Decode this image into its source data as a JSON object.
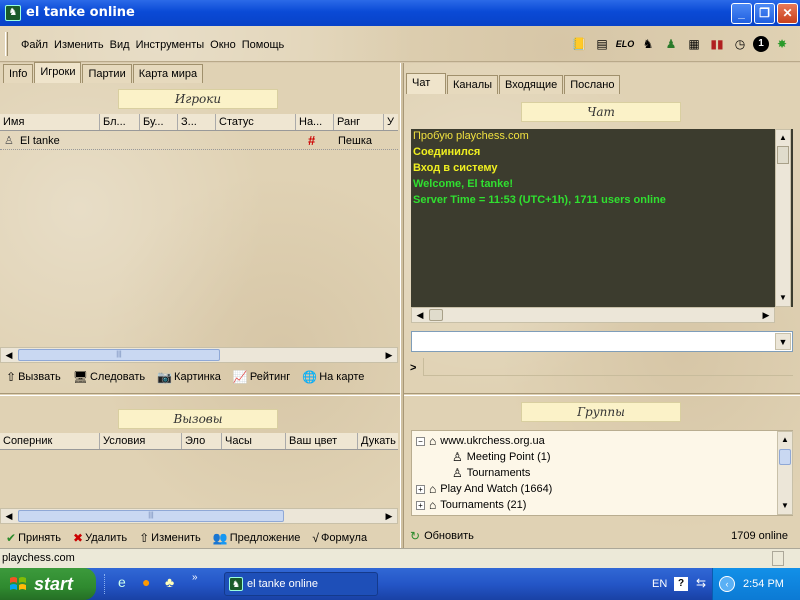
{
  "window": {
    "title": "el tanke online",
    "app_icon": "chess-knight-icon"
  },
  "menu": {
    "items": [
      "Файл",
      "Изменить",
      "Вид",
      "Инструменты",
      "Окно",
      "Помощь"
    ]
  },
  "toolbar": {
    "icons": [
      "book-icon",
      "list-icon",
      "elo-icon",
      "knight-icon",
      "player-icon",
      "board-icon",
      "chart-icon",
      "clock-icon",
      "number-one-icon",
      "star-icon"
    ],
    "elo_label": "ELO"
  },
  "left": {
    "tabs": [
      "Info",
      "Игроки",
      "Партии",
      "Карта мира"
    ],
    "active_tab": "Игроки",
    "players": {
      "title": "Игроки",
      "columns": [
        "Имя",
        "Бл...",
        "Бу...",
        "З...",
        "Статус",
        "На...",
        "Ранг",
        "У"
      ],
      "rows": [
        {
          "name": "El tanke",
          "flag": "#",
          "rank": "Пешка"
        }
      ]
    },
    "player_buttons": [
      "Вызвать",
      "Следовать",
      "Картинка",
      "Рейтинг",
      "На карте"
    ],
    "challenges": {
      "title": "Вызовы",
      "columns": [
        "Соперник",
        "Условия",
        "Эло",
        "Часы",
        "Ваш цвет",
        "Дукать"
      ]
    },
    "challenge_buttons": [
      "Принять",
      "Удалить",
      "Изменить",
      "Предложение",
      "Формула"
    ]
  },
  "right": {
    "tabs": [
      "Чат",
      "Каналы",
      "Входящие",
      "Послано"
    ],
    "active_tab": "Чат",
    "chat_title": "Чат",
    "chat_lines": [
      {
        "text": "Пробую playchess.com",
        "color": "#f0e040"
      },
      {
        "text": "Соединился",
        "color": "#f0f020"
      },
      {
        "text": "Вход в систему",
        "color": "#f0f020"
      },
      {
        "text": "Welcome, El tanke!",
        "color": "#30e030"
      },
      {
        "text": "Server Time = 11:53 (UTC+1h), 1711 users online",
        "color": "#30e030"
      }
    ],
    "prompt": ">",
    "groups_title": "Группы",
    "groups": [
      {
        "label": "www.ukrchess.org.ua",
        "level": 0,
        "expander": "−"
      },
      {
        "label": "Meeting Point  (1)",
        "level": 1,
        "expander": ""
      },
      {
        "label": "Tournaments",
        "level": 1,
        "expander": ""
      },
      {
        "label": "Play And Watch  (1664)",
        "level": 0,
        "expander": "+"
      },
      {
        "label": "Tournaments  (21)",
        "level": 0,
        "expander": "+"
      }
    ],
    "refresh_label": "Обновить",
    "online_count": "1709 online"
  },
  "status": {
    "text": "playchess.com"
  },
  "taskbar": {
    "start_label": "start",
    "task_label": "el tanke online",
    "lang": "EN",
    "time": "2:54 PM"
  },
  "colors": {
    "chat_bg": "#3c3c2e",
    "title_blue": "#0a4ad6",
    "parchment": "#e0d2b4"
  }
}
